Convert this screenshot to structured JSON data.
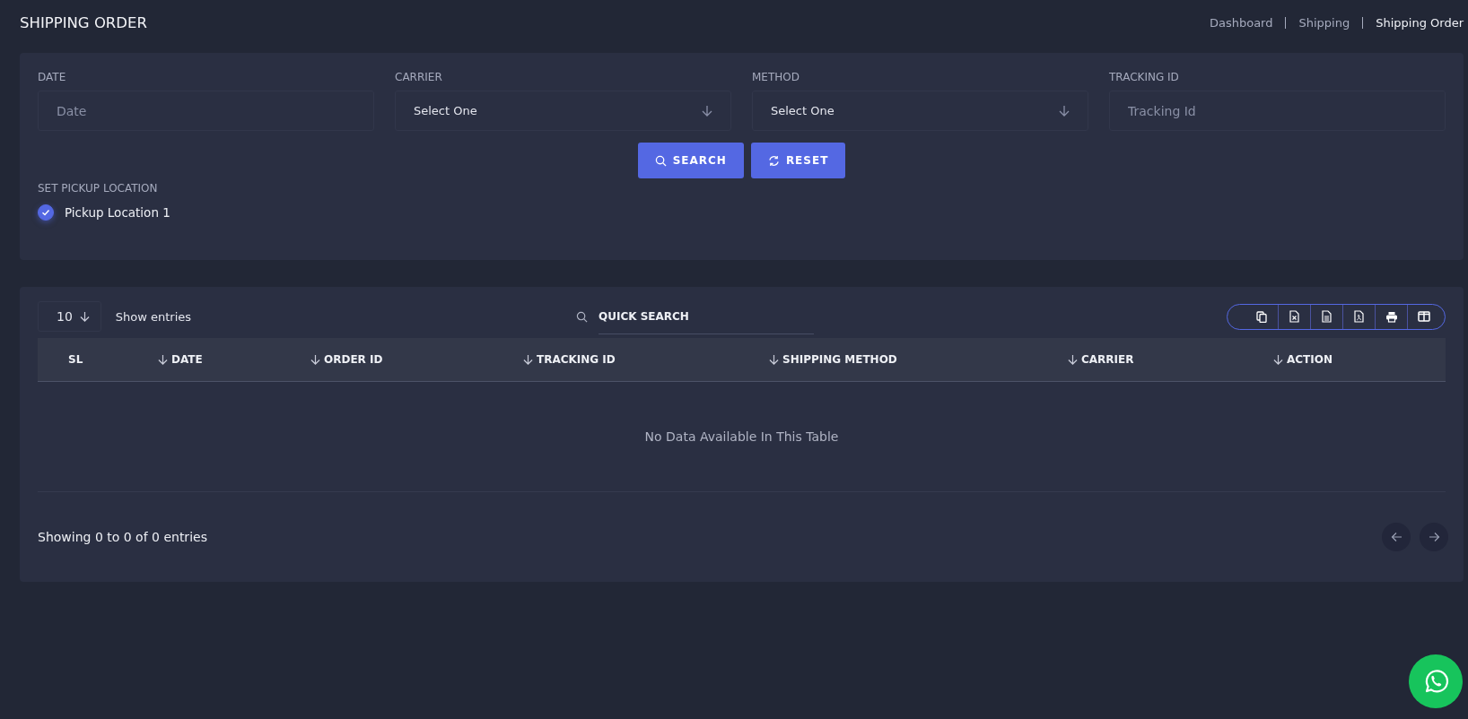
{
  "page_title": "SHIPPING ORDER",
  "breadcrumbs": [
    {
      "label": "Dashboard",
      "selected": false
    },
    {
      "label": "Shipping",
      "selected": false
    },
    {
      "label": "Shipping Order",
      "selected": true
    }
  ],
  "filters": [
    {
      "label": "DATE",
      "kind": "input",
      "placeholder": "Date"
    },
    {
      "label": "CARRIER",
      "kind": "select",
      "value": "Select One"
    },
    {
      "label": "METHOD",
      "kind": "select",
      "value": "Select One"
    },
    {
      "label": "TRACKING ID",
      "kind": "input",
      "placeholder": "Tracking Id"
    }
  ],
  "buttons": [
    {
      "label": "SEARCH",
      "kind": "search"
    },
    {
      "label": "RESET",
      "kind": "reset"
    }
  ],
  "pickup": {
    "label": "SET PICKUP LOCATION",
    "options": [
      {
        "label": "Pickup Location 1",
        "checked": true
      }
    ]
  },
  "table": {
    "page_size": "10",
    "page_size_label": "Show entries",
    "quick_search": {
      "placeholder": "QUICK SEARCH"
    },
    "columns": [
      {
        "label": "SL",
        "sortable": false
      },
      {
        "label": "DATE",
        "sortable": true
      },
      {
        "label": "ORDER ID",
        "sortable": true
      },
      {
        "label": "TRACKING ID",
        "sortable": true
      },
      {
        "label": "SHIPPING METHOD",
        "sortable": true
      },
      {
        "label": "CARRIER",
        "sortable": true
      },
      {
        "label": "ACTION",
        "sortable": true
      }
    ],
    "empty_message": "No Data Available In This Table",
    "info": "Showing 0 to 0 of 0 entries"
  }
}
